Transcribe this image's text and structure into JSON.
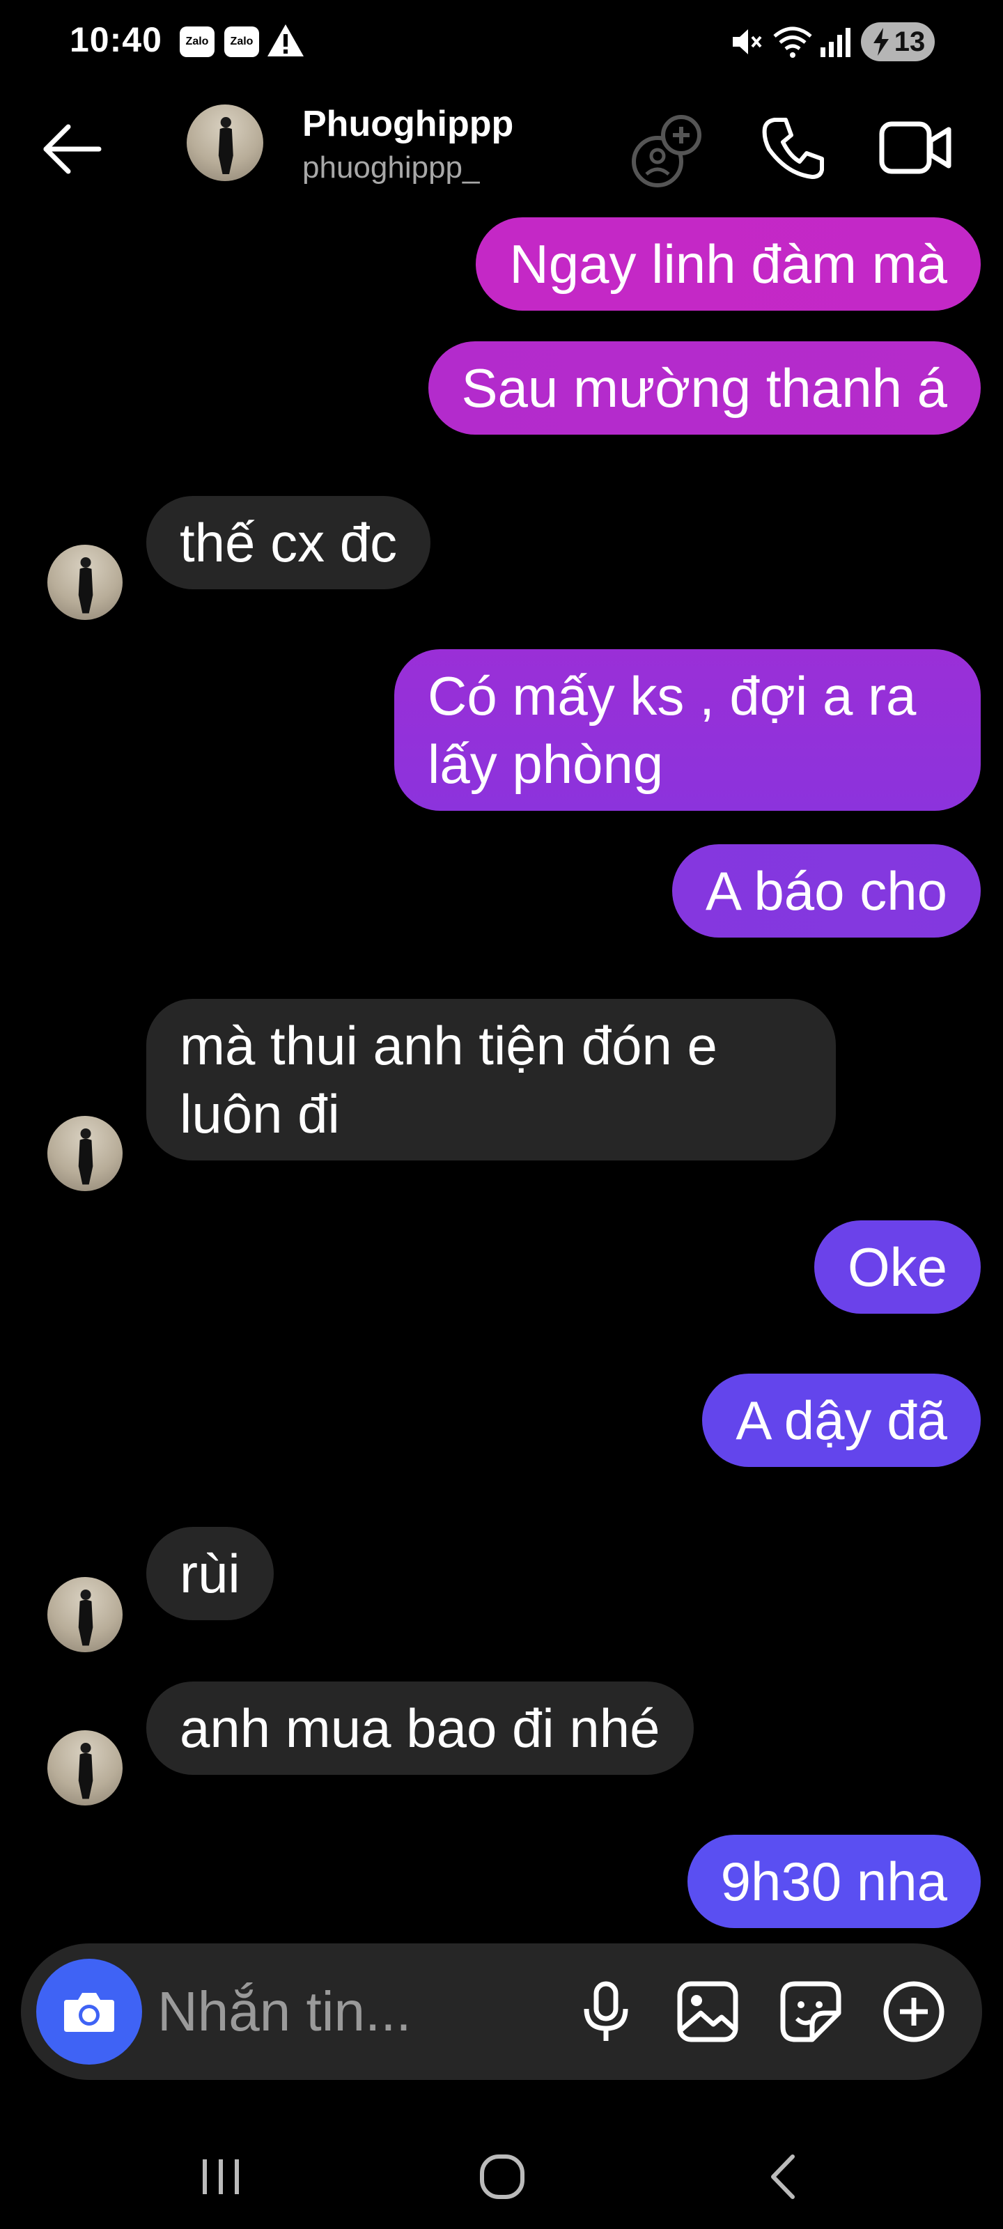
{
  "status_bar": {
    "time": "10:40",
    "notification_apps": [
      "Zalo",
      "Zalo"
    ],
    "battery": "13"
  },
  "header": {
    "name": "Phuoghippp",
    "handle": "phuoghippp_"
  },
  "messages": [
    {
      "side": "sent",
      "text": "Ngay linh đàm mà"
    },
    {
      "side": "sent",
      "text": "Sau mường thanh á"
    },
    {
      "side": "received",
      "text": "thế cx đc"
    },
    {
      "side": "sent",
      "text": "Có mấy ks , đợi a ra lấy phòng"
    },
    {
      "side": "sent",
      "text": "A báo cho"
    },
    {
      "side": "received",
      "text": "mà thui anh tiện đón e luôn đi"
    },
    {
      "side": "sent",
      "text": "Oke"
    },
    {
      "side": "sent",
      "text": "A dậy đã"
    },
    {
      "side": "received",
      "text": "rùi"
    },
    {
      "side": "received",
      "text": "anh mua bao đi nhé"
    },
    {
      "side": "sent",
      "text": "9h30 nha"
    }
  ],
  "composer": {
    "placeholder": "Nhắn tin..."
  },
  "colors": {
    "background": "#000000",
    "received_bubble": "#262626",
    "sent_gradient_top": "#c026c6",
    "sent_gradient_bottom": "#5a4ff2",
    "camera_button": "#3f63f5"
  },
  "icons": {
    "header": [
      "back-arrow-icon",
      "add-people-icon",
      "phone-icon",
      "video-camera-icon"
    ],
    "composer": [
      "camera-icon",
      "microphone-icon",
      "gallery-icon",
      "sticker-icon",
      "plus-circle-icon"
    ],
    "nav": [
      "recents-icon",
      "home-icon",
      "back-icon"
    ]
  }
}
